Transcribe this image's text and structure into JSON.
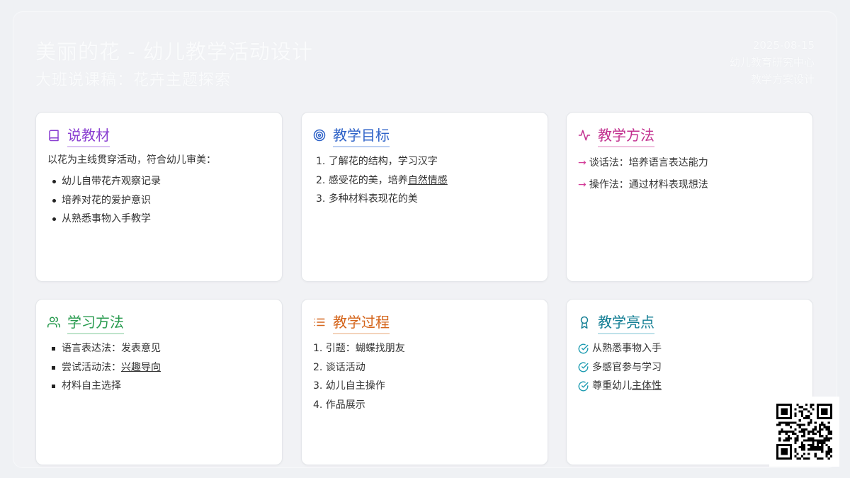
{
  "header": {
    "title": "美丽的花 - 幼儿教学活动设计",
    "subtitle": "大班说课稿：花卉主题探索",
    "date": "2025-08-15",
    "org": "幼儿教育研究中心",
    "doc_type": "教学方案设计"
  },
  "cards": {
    "material": {
      "title": "说教材",
      "icon": "book-icon",
      "intro": "以花为主线贯穿活动，符合幼儿审美：",
      "items": [
        "幼儿自带花卉观察记录",
        "培养对花的爱护意识",
        "从熟悉事物入手教学"
      ]
    },
    "goals": {
      "title": "教学目标",
      "icon": "target-icon",
      "items": [
        {
          "num": "1.",
          "text": "了解花的结构，学习汉字",
          "underline": ""
        },
        {
          "num": "2.",
          "text": "感受花的美，培养",
          "underline": "自然情感"
        },
        {
          "num": "3.",
          "text": "多种材料表现花的美",
          "underline": ""
        }
      ]
    },
    "methods": {
      "title": "教学方法",
      "icon": "activity-icon",
      "arrow": "→",
      "items": [
        "谈话法：培养语言表达能力",
        "操作法：通过材料表现想法"
      ]
    },
    "learning": {
      "title": "学习方法",
      "icon": "users-icon",
      "items": [
        {
          "text": "语言表达法：发表意见",
          "underline": ""
        },
        {
          "text": "尝试活动法：",
          "underline": "兴趣导向"
        },
        {
          "text": "材料自主选择",
          "underline": ""
        }
      ]
    },
    "process": {
      "title": "教学过程",
      "icon": "list-icon",
      "items": [
        "1. 引题：蝴蝶找朋友",
        "2. 谈话活动",
        "3. 幼儿自主操作",
        "4. 作品展示"
      ]
    },
    "highlights": {
      "title": "教学亮点",
      "icon": "award-icon",
      "items": [
        {
          "text": "从熟悉事物入手",
          "underline": ""
        },
        {
          "text": "多感官参与学习",
          "underline": ""
        },
        {
          "text": "尊重幼儿",
          "underline": "主体性"
        }
      ]
    }
  },
  "colors": {
    "purple": "#8a3fd1",
    "blue": "#2f63c8",
    "pink": "#c2308f",
    "green": "#279a4e",
    "orange": "#d4641a",
    "teal": "#137e94"
  },
  "qr": {
    "icon": "qr-code-icon"
  }
}
